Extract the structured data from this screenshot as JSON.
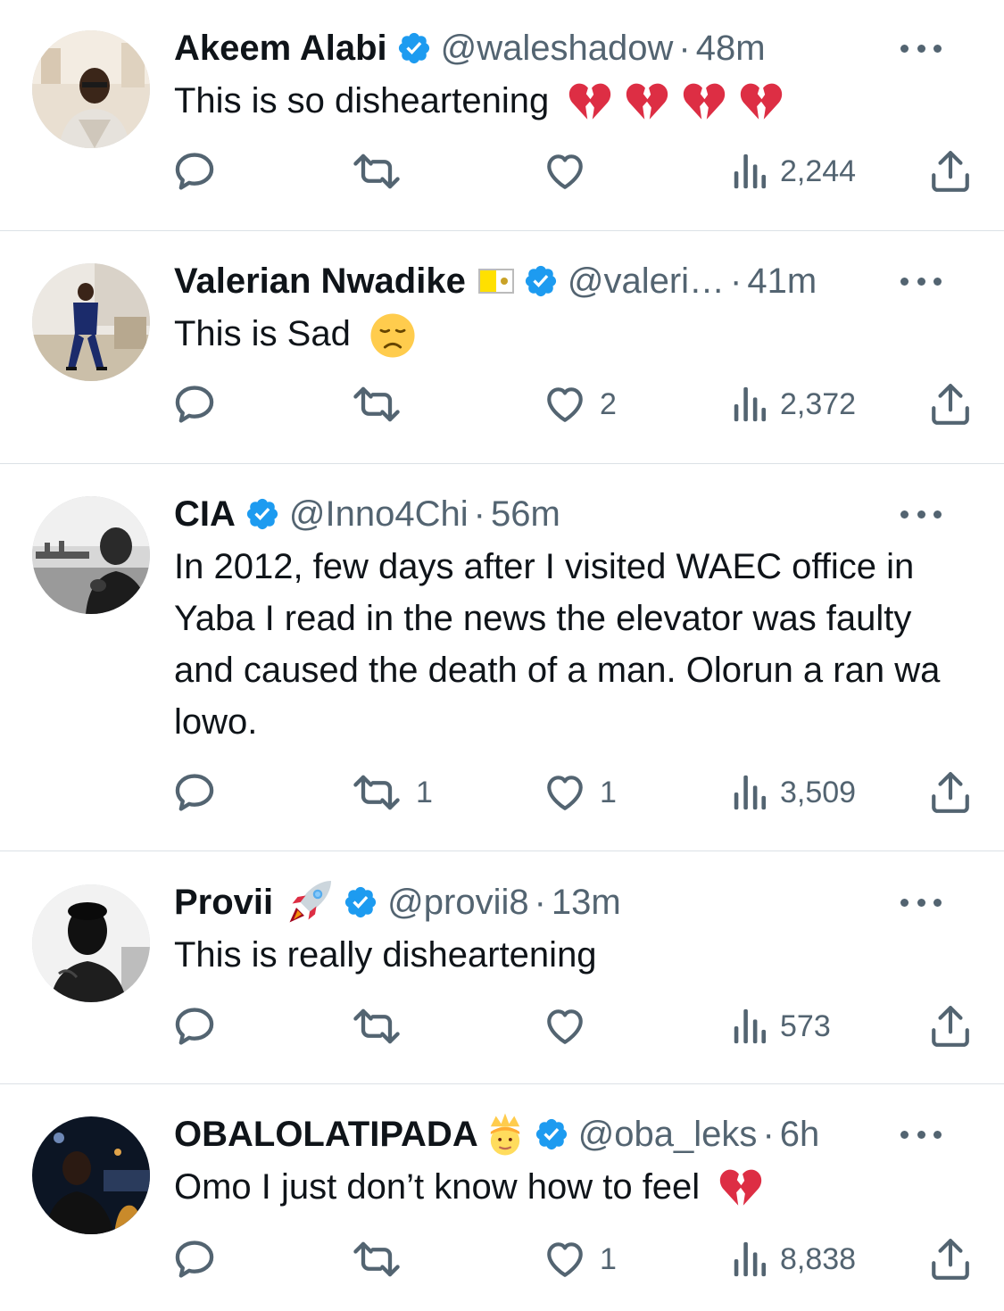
{
  "colors": {
    "text": "#0f1419",
    "secondary": "#536471",
    "verified": "#1d9bf0",
    "divider": "#dbe1e6"
  },
  "tweets": [
    {
      "name": "Akeem Alabi",
      "name_emoji": "",
      "verified": true,
      "handle": "@waleshadow",
      "separator": "·",
      "time": "48m",
      "text": "This is so disheartening",
      "text_emojis": [
        "broken-heart",
        "broken-heart",
        "broken-heart",
        "broken-heart"
      ],
      "replies": "",
      "retweets": "",
      "likes": "",
      "views": "2,244"
    },
    {
      "name": "Valerian Nwadike",
      "name_emoji": "vatican-flag",
      "verified": true,
      "handle": "@valeri…",
      "separator": "·",
      "time": "41m",
      "text": "This is Sad",
      "text_emojis": [
        "disappointed-face"
      ],
      "replies": "",
      "retweets": "",
      "likes": "2",
      "views": "2,372"
    },
    {
      "name": "CIA",
      "name_emoji": "",
      "verified": true,
      "handle": "@Inno4Chi",
      "separator": "·",
      "time": "56m",
      "text": "In 2012, few days after I visited WAEC office in Yaba I read in the news the elevator was faulty and caused the death of a man. Olorun a ran wa lowo.",
      "text_emojis": [],
      "replies": "",
      "retweets": "1",
      "likes": "1",
      "views": "3,509"
    },
    {
      "name": "Provii",
      "name_emoji": "rocket",
      "verified": true,
      "handle": "@provii8",
      "separator": "·",
      "time": "13m",
      "text": "This is really disheartening",
      "text_emojis": [],
      "replies": "",
      "retweets": "",
      "likes": "",
      "views": "573"
    },
    {
      "name": "OBALOLATIPADA",
      "name_emoji": "prince",
      "verified": true,
      "handle": "@oba_leks",
      "separator": "·",
      "time": "6h",
      "text": "Omo I just don’t know how to feel",
      "text_emojis": [
        "broken-heart"
      ],
      "replies": "",
      "retweets": "",
      "likes": "1",
      "views": "8,838"
    }
  ]
}
